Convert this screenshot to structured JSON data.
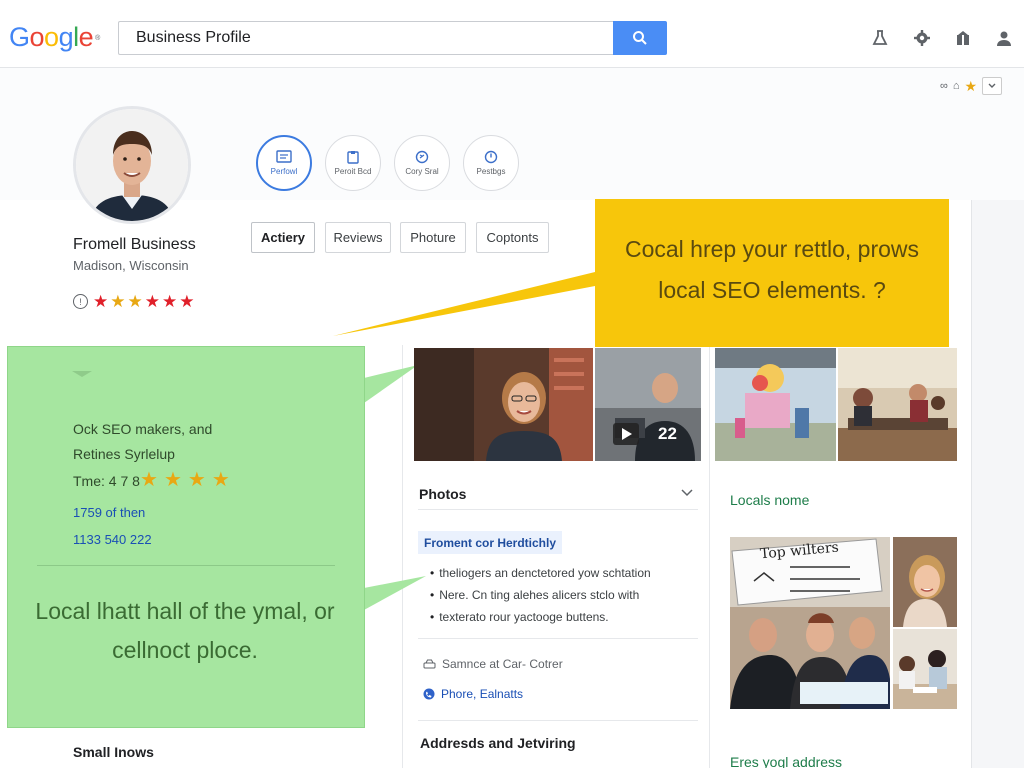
{
  "header": {
    "logo_letters": [
      {
        "ch": "G",
        "color": "#4285f4"
      },
      {
        "ch": "o",
        "color": "#ea4335"
      },
      {
        "ch": "o",
        "color": "#fbbc05"
      },
      {
        "ch": "g",
        "color": "#4285f4"
      },
      {
        "ch": "l",
        "color": "#34a853"
      },
      {
        "ch": "e",
        "color": "#ea4335"
      }
    ],
    "logo_suffix": "®",
    "search_value": "Business Profile",
    "icons": [
      "flask-icon",
      "gear-icon",
      "gift-icon",
      "account-icon"
    ]
  },
  "mini_tools": {
    "text": "ꟿ"
  },
  "profile": {
    "name": "Fromell Business",
    "location": "Madison, Wisconsin",
    "actions": [
      {
        "label": "Perfowl",
        "icon": "edit-icon",
        "active": true
      },
      {
        "label": "Peroit Bcd",
        "icon": "clipboard-icon",
        "active": false
      },
      {
        "label": "Cory Sral",
        "icon": "share-icon",
        "active": false
      },
      {
        "label": "Pestbgs",
        "icon": "clock-icon",
        "active": false
      }
    ],
    "tabs": [
      "Actiery",
      "Reviews",
      "Photure",
      "Coptonts"
    ],
    "rating_stars": [
      "#e0202a",
      "#e8a814",
      "#e8a814",
      "#e0202a",
      "#e0202a",
      "#e0202a"
    ]
  },
  "callout_yellow": {
    "line1": "Cocal hrep your rettlo, prows",
    "line2": "local SEO elements.  ?"
  },
  "callout_green": {
    "line1": "Ock SEO makers, and",
    "line2": "Retines Syrlelup",
    "rating_label": "Tme: 4 7 8",
    "link1": "1759 of then",
    "link2": "1133 540 222",
    "big_text": "Local lhatt hall of the ymal, or cellnoct ploce."
  },
  "photos_section": {
    "title": "Photos",
    "tag": "Froment cor Herdtichly",
    "bullets": [
      "theliogers an denctetored yow schtation",
      "Nere. Cn ting alehes alicers stclo with",
      "texterato rour yactooge buttens."
    ],
    "service_label": "Samnce at Car- Cotrer",
    "phone_label": "Phore, Ealnatts",
    "address_title": "Addresds and Jetviring",
    "video_time": "22"
  },
  "right_column": {
    "locals_label": "Locals nome",
    "sign_text": "Top wilters",
    "bottom_label": "Eres yogl address"
  },
  "left_bottom": {
    "label": "Small Inows"
  },
  "colors": {
    "accent_blue": "#4a8df5",
    "callout_yellow": "#f7c60b",
    "callout_green": "#a6e6a0",
    "star_gold": "#e8a814",
    "star_red": "#e0202a"
  }
}
